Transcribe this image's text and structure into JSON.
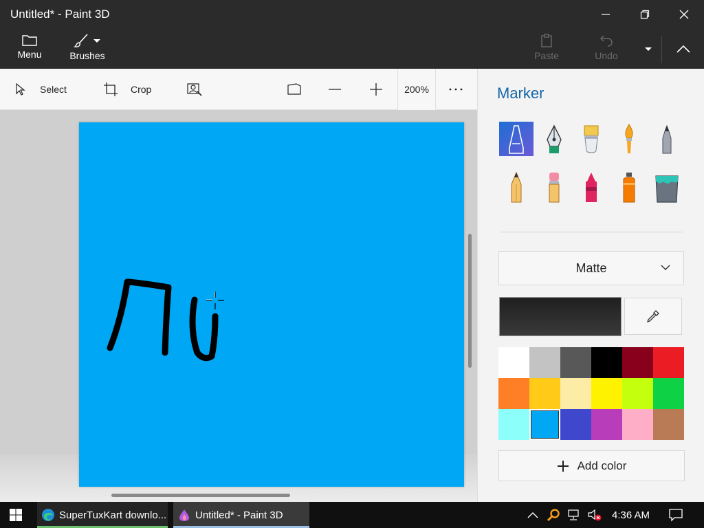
{
  "window": {
    "title": "Untitled* - Paint 3D",
    "controls": [
      "minimize-icon",
      "restore-icon",
      "close-icon"
    ]
  },
  "ribbon": {
    "menu_label": "Menu",
    "brushes_label": "Brushes",
    "paste_label": "Paste",
    "undo_label": "Undo",
    "paste_enabled": false,
    "undo_enabled": false
  },
  "toolbar": {
    "select_label": "Select",
    "crop_label": "Crop",
    "zoom_level": "200%",
    "icons": [
      "select-icon",
      "crop-icon",
      "magic-select-icon",
      "view-3d-icon",
      "zoom-out-icon",
      "zoom-in-icon",
      "more-icon"
    ]
  },
  "canvas": {
    "background_color": "#00a7f5",
    "stroke_color": "#000000"
  },
  "panel": {
    "title": "Marker",
    "brushes": [
      {
        "name": "marker",
        "selected": true
      },
      {
        "name": "calligraphy-pen",
        "selected": false
      },
      {
        "name": "oil-brush",
        "selected": false
      },
      {
        "name": "watercolor",
        "selected": false
      },
      {
        "name": "pixel-pen",
        "selected": false
      },
      {
        "name": "pencil",
        "selected": false
      },
      {
        "name": "eraser",
        "selected": false
      },
      {
        "name": "crayon",
        "selected": false
      },
      {
        "name": "spray-can",
        "selected": false
      },
      {
        "name": "fill",
        "selected": false
      }
    ],
    "finish_value": "Matte",
    "current_color": "#1f1f1f",
    "palette": [
      "#ffffff",
      "#c3c3c3",
      "#585858",
      "#000000",
      "#88001b",
      "#ec1c24",
      "#ff7f27",
      "#ffca18",
      "#fdeca6",
      "#fff200",
      "#c4ff0e",
      "#0ed145",
      "#8cfffb",
      "#00a8f3",
      "#3f48cc",
      "#b83dba",
      "#ffaec8",
      "#b97a56"
    ],
    "selected_swatch": 13,
    "add_color_label": "Add color"
  },
  "taskbar": {
    "tasks": [
      {
        "label": "SuperTuxKart downlo...",
        "icon": "edge-icon"
      },
      {
        "label": "Untitled* - Paint 3D",
        "icon": "paint3d-icon",
        "active": true
      }
    ],
    "time": "4:36 AM",
    "tray_icons": [
      "chevron-up-icon",
      "search-tray-icon",
      "network-icon",
      "volume-muted-icon",
      "notification-icon"
    ]
  }
}
